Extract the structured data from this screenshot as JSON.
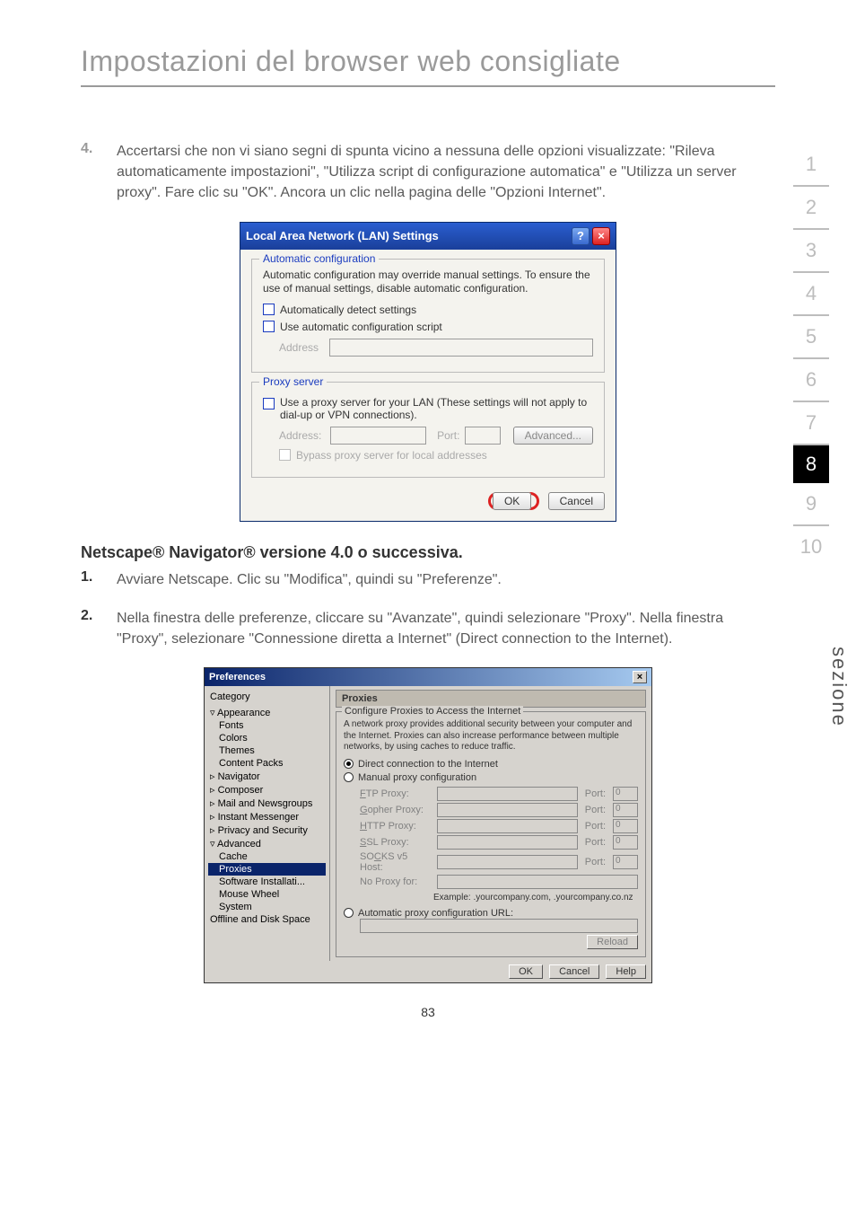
{
  "heading": "Impostazioni del browser web consigliate",
  "step4": {
    "num": "4.",
    "text": "Accertarsi che non vi siano segni di spunta vicino a nessuna delle opzioni visualizzate: \"Rileva automaticamente impostazioni\", \"Utilizza script di configurazione automatica\" e \"Utilizza un server proxy\". Fare clic su \"OK\". Ancora un clic nella pagina delle \"Opzioni Internet\"."
  },
  "lan": {
    "title": "Local Area Network (LAN) Settings",
    "legend1": "Automatic configuration",
    "desc1": "Automatic configuration may override manual settings.  To ensure the use of manual settings, disable automatic configuration.",
    "chk1": "Automatically detect settings",
    "chk2": "Use automatic configuration script",
    "addr_ph": "Address",
    "legend2": "Proxy server",
    "chk3": "Use a proxy server for your LAN (These settings will not apply to dial-up or VPN connections).",
    "addr2": "Address:",
    "port": "Port:",
    "adv": "Advanced...",
    "chk4": "Bypass proxy server for local addresses",
    "ok": "OK",
    "cancel": "Cancel"
  },
  "netscape_heading": "Netscape® Navigator® versione 4.0 o successiva.",
  "step1": {
    "num": "1.",
    "text": "Avviare Netscape. Clic su \"Modifica\", quindi su \"Preferenze\"."
  },
  "step2": {
    "num": "2.",
    "text": "Nella finestra delle preferenze, cliccare su \"Avanzate\", quindi selezionare \"Proxy\". Nella finestra \"Proxy\", selezionare \"Connessione diretta a Internet\" (Direct connection to the Internet)."
  },
  "ns": {
    "title": "Preferences",
    "cat": "Category",
    "tree": {
      "appearance": "Appearance",
      "fonts": "Fonts",
      "colors": "Colors",
      "themes": "Themes",
      "content": "Content Packs",
      "navigator": "Navigator",
      "composer": "Composer",
      "mail": "Mail and Newsgroups",
      "im": "Instant Messenger",
      "privsec": "Privacy and Security",
      "advanced": "Advanced",
      "cache": "Cache",
      "proxies": "Proxies",
      "software": "Software Installati...",
      "mouse": "Mouse Wheel",
      "system": "System",
      "offline": "Offline and Disk Space"
    },
    "panel_title": "Proxies",
    "fs_legend": "Configure Proxies to Access the Internet",
    "fs_desc": "A network proxy provides additional security between your computer and the Internet. Proxies can also increase performance between multiple networks, by using caches to reduce traffic.",
    "r1": "Direct connection to the Internet",
    "r2": "Manual proxy configuration",
    "ftp": "FTP Proxy:",
    "gopher": "Gopher Proxy:",
    "http": "HTTP Proxy:",
    "ssl": "SSL Proxy:",
    "socks": "SOCKS v5 Host:",
    "noproxy": "No Proxy for:",
    "port_l": "Port:",
    "port_v": "0",
    "example": "Example: .yourcompany.com, .yourcompany.co.nz",
    "r3": "Automatic proxy configuration URL:",
    "reload": "Reload",
    "ok": "OK",
    "cancel": "Cancel",
    "help": "Help"
  },
  "side": {
    "tabs": [
      "1",
      "2",
      "3",
      "4",
      "5",
      "6",
      "7",
      "8",
      "9",
      "10"
    ],
    "active_index": 7,
    "label": "sezione"
  },
  "pagenum": "83"
}
